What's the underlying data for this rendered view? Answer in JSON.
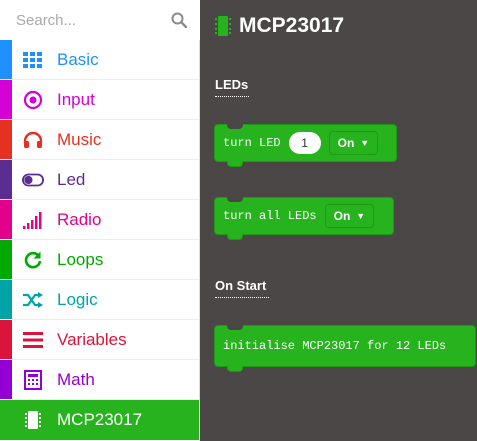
{
  "search": {
    "placeholder": "Search..."
  },
  "categories": [
    {
      "label": "Basic",
      "color": "#1e90ff",
      "icon": "grid-icon"
    },
    {
      "label": "Input",
      "color": "#d400d4",
      "icon": "target-icon"
    },
    {
      "label": "Music",
      "color": "#e63022",
      "icon": "headphones-icon"
    },
    {
      "label": "Led",
      "color": "#5c2d91",
      "icon": "toggle-icon"
    },
    {
      "label": "Radio",
      "color": "#e3008c",
      "icon": "signal-bars-icon"
    },
    {
      "label": "Loops",
      "color": "#00aa00",
      "icon": "refresh-icon"
    },
    {
      "label": "Logic",
      "color": "#00a4a6",
      "icon": "shuffle-icon"
    },
    {
      "label": "Variables",
      "color": "#dc143c",
      "icon": "list-icon"
    },
    {
      "label": "Math",
      "color": "#9400d3",
      "icon": "calculator-icon"
    },
    {
      "label": "MCP23017",
      "color": "#27b31e",
      "icon": "chip-icon",
      "selected": true
    }
  ],
  "flyout": {
    "title": "MCP23017",
    "sections": [
      {
        "label": "LEDs"
      },
      {
        "label": "On Start"
      }
    ],
    "blocks": {
      "turn_led": {
        "text": "turn LED",
        "value": "1",
        "dropdown": "On"
      },
      "turn_all": {
        "text": "turn all LEDs",
        "dropdown": "On"
      },
      "initialise": {
        "text": "initialise MCP23017 for 12 LEDs"
      }
    }
  }
}
